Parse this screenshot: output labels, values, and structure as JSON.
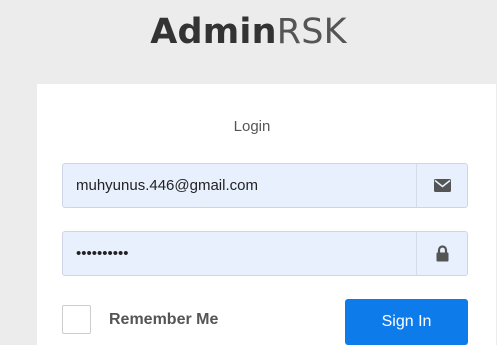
{
  "logo": {
    "part1": "Admin",
    "part2": "RSK"
  },
  "login_box": {
    "title": "Login",
    "email": {
      "value": "muhyunus.446@gmail.com",
      "icon": "envelope-icon"
    },
    "password": {
      "value": "••••••••••",
      "icon": "lock-icon"
    },
    "remember_me": {
      "label": "Remember Me",
      "checked": false
    },
    "sign_in_label": "Sign In"
  },
  "colors": {
    "background": "#ececec",
    "input_autofill": "#e8f0fe",
    "primary_button": "#0e7bea",
    "icon": "#555555"
  }
}
